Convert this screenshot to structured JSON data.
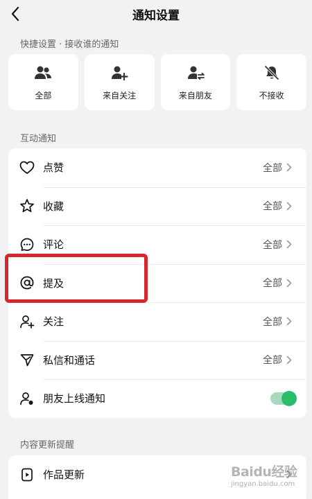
{
  "header": {
    "title": "通知设置"
  },
  "quick_settings": {
    "section_label": "快捷设置 · 接收谁的通知",
    "options": [
      {
        "label": "全部",
        "icon": "users-icon"
      },
      {
        "label": "来自关注",
        "icon": "user-plus-icon"
      },
      {
        "label": "来自朋友",
        "icon": "user-swap-icon"
      },
      {
        "label": "不接收",
        "icon": "bell-off-icon"
      }
    ]
  },
  "interaction": {
    "section_label": "互动通知",
    "items": [
      {
        "label": "点赞",
        "value": "全部",
        "icon": "heart-icon"
      },
      {
        "label": "收藏",
        "value": "全部",
        "icon": "star-icon"
      },
      {
        "label": "评论",
        "value": "全部",
        "icon": "comment-icon"
      },
      {
        "label": "提及",
        "value": "全部",
        "icon": "at-icon"
      },
      {
        "label": "关注",
        "value": "全部",
        "icon": "user-add-icon"
      },
      {
        "label": "私信和通话",
        "value": "全部",
        "icon": "send-icon"
      },
      {
        "label": "朋友上线通知",
        "toggle_on": true,
        "icon": "user-online-icon"
      }
    ]
  },
  "content_updates": {
    "section_label": "内容更新提醒",
    "items": [
      {
        "label": "作品更新",
        "icon": "video-icon"
      }
    ]
  },
  "watermark": {
    "brand": "Baidu经验",
    "url": "jingyan.baidu.com"
  },
  "colors": {
    "toggle_on": "#2bbd6b",
    "highlight": "#d7262e",
    "background": "#f2f2f4"
  }
}
